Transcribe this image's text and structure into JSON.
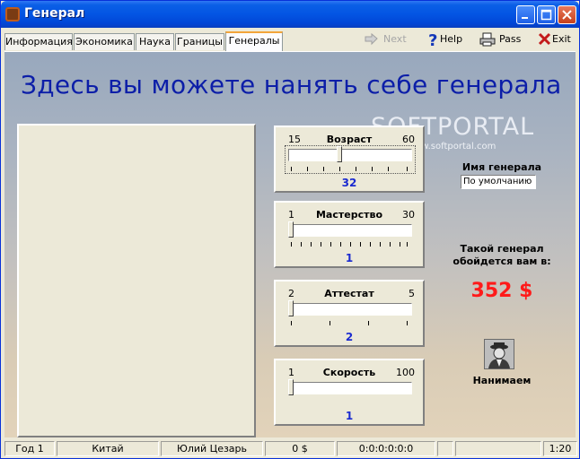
{
  "window": {
    "title": "Генерал",
    "icon": "general-app-icon"
  },
  "titlebar_buttons": [
    {
      "name": "minimize-button",
      "icon": "minimize-icon"
    },
    {
      "name": "maximize-button",
      "icon": "maximize-icon"
    },
    {
      "name": "close-button",
      "icon": "close-icon"
    }
  ],
  "tabs": [
    "Информация",
    "Экономика",
    "Наука",
    "Границы",
    "Генералы"
  ],
  "active_tab": "Генералы",
  "toolbar": {
    "next_label": "Next",
    "next_icon": "arrow-right-icon",
    "next_enabled": false,
    "help_label": "Help",
    "help_icon": "question-icon",
    "pass_label": "Pass",
    "pass_icon": "printer-icon",
    "exit_label": "Exit",
    "exit_icon": "x-mark-icon"
  },
  "main": {
    "headline": "Здесь вы можете нанять себе генерала",
    "watermark": "SOFTPORTAL",
    "watermark_url": "www.softportal.com"
  },
  "sliders": {
    "age": {
      "title": "Возраст",
      "min": "15",
      "max": "60",
      "value": "32"
    },
    "skill": {
      "title": "Мастерство",
      "min": "1",
      "max": "30",
      "value": "1"
    },
    "certificate": {
      "title": "Аттестат",
      "min": "2",
      "max": "5",
      "value": "2"
    },
    "speed": {
      "title": "Скорость",
      "min": "1",
      "max": "100",
      "value": "1"
    }
  },
  "general_name": {
    "label": "Имя генерала",
    "value": "По умолчанию"
  },
  "cost": {
    "label_line1": "Такой генерал",
    "label_line2": "обойдется вам в:",
    "price": "352 $",
    "color": "#ff1a1a"
  },
  "hire": {
    "label": "Нанимаем",
    "icon": "general-portrait-icon"
  },
  "statusbar": {
    "year": "Год 1",
    "country": "Китай",
    "ruler": "Юлий Цезарь",
    "money": "0 $",
    "counts": "0:0:0:0:0:0",
    "extra1": "",
    "extra2": "",
    "time": "1:20"
  },
  "colors": {
    "headline": "#0c1ea8",
    "value_blue": "#1b2bd0",
    "title_bar": "#0355e3"
  }
}
